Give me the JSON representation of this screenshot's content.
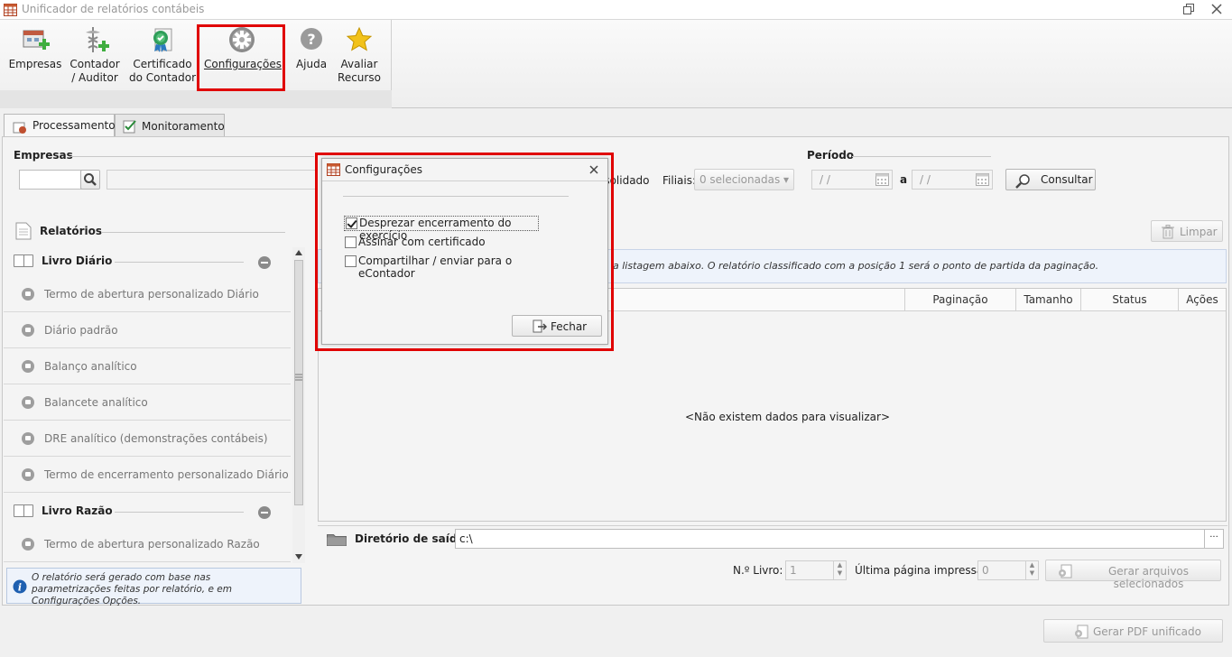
{
  "window": {
    "title": "Unificador de relatórios contábeis"
  },
  "ribbon": {
    "buttons": [
      {
        "label": "Empresas"
      },
      {
        "label": "Contador\n/ Auditor"
      },
      {
        "label": "Certificado\ndo Contador"
      },
      {
        "label": "Configurações"
      },
      {
        "label": "Ajuda"
      },
      {
        "label": "Avaliar\nRecurso"
      }
    ]
  },
  "tabs": [
    {
      "label": "Processamento",
      "active": true
    },
    {
      "label": "Monitoramento",
      "active": false
    }
  ],
  "filters": {
    "empresas_label": "Empresas",
    "periodo_label": "Período",
    "consolidado_label": "Consolidado",
    "filiais_label": "Filiais:",
    "filiais_value": "0 selecionadas",
    "date_from": "/ /",
    "date_to": "/ /",
    "date_sep": "a",
    "consultar_label": "Consultar"
  },
  "left_panel": {
    "title": "Relatórios",
    "groups": [
      {
        "title": "Livro Diário",
        "items": [
          "Termo de abertura personalizado Diário",
          "Diário padrão",
          "Balanço analítico",
          "Balancete analítico",
          "DRE analítico (demonstrações contábeis)",
          "Termo de encerramento personalizado Diário"
        ]
      },
      {
        "title": "Livro Razão",
        "items": [
          "Termo de abertura personalizado Razão"
        ]
      }
    ],
    "info_text": "O relatório será gerado com base nas parametrizações feitas por relatório, e em Configurações Opções."
  },
  "right_panel": {
    "limpar_label": "Limpar",
    "info_text": "a listagem abaixo. O relatório classificado com a posição 1 será o ponto de partida da paginação.",
    "columns": [
      "Paginação",
      "Tamanho",
      "Status",
      "Ações"
    ],
    "empty_text": "<Não existem dados para visualizar>",
    "output_dir_label": "Diretório de saída:",
    "output_dir_value": "c:\\",
    "browse_label": "···",
    "livro_label": "N.º Livro:",
    "livro_value": "1",
    "ultima_label": "Última página impressa:",
    "ultima_value": "0",
    "gerar_selecionados_label": "Gerar arquivos selecionados"
  },
  "footer": {
    "gerar_pdf_label": "Gerar PDF unificado"
  },
  "dialog": {
    "title": "Configurações",
    "options": [
      {
        "label": "Desprezar encerramento do exercício",
        "checked": true
      },
      {
        "label": "Assinar com certificado",
        "checked": false
      },
      {
        "label": "Compartilhar / enviar para o eContador",
        "checked": false
      }
    ],
    "fechar_label": "Fechar"
  }
}
